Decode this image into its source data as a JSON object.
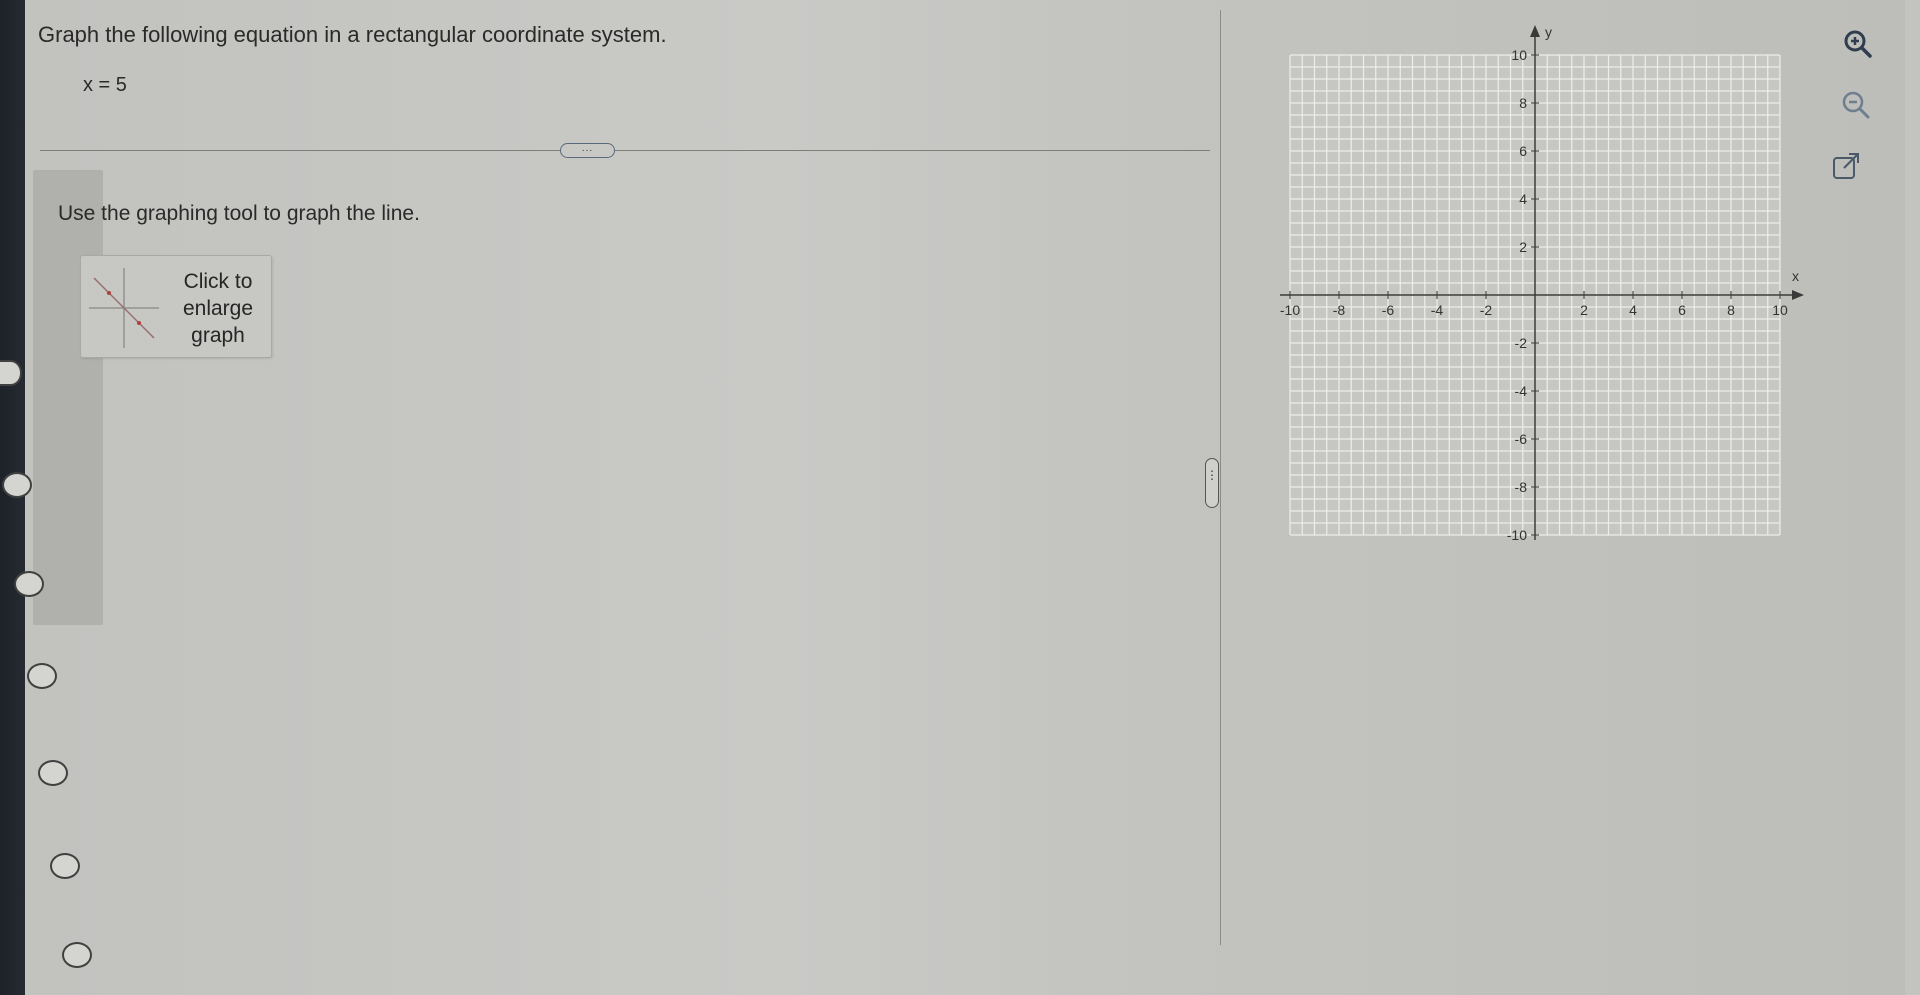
{
  "question": {
    "prompt": "Graph the following equation in a rectangular coordinate system.",
    "equation": "x = 5"
  },
  "more_button_label": "...",
  "instruction": "Use the graphing tool to graph the line.",
  "enlarge_button": {
    "lines": [
      "Click to",
      "enlarge",
      "graph"
    ]
  },
  "graph": {
    "x_label": "x",
    "y_label": "y",
    "x_range": [
      -10,
      10
    ],
    "y_range": [
      -10,
      10
    ],
    "minor_step": 1,
    "x_tick_labels": [
      "-10",
      "-8",
      "-6",
      "-4",
      "-2",
      "2",
      "4",
      "6",
      "8",
      "10"
    ],
    "y_tick_labels": [
      "10",
      "8",
      "6",
      "4",
      "2",
      "-2",
      "-4",
      "-6",
      "-8",
      "-10"
    ],
    "grid": true
  },
  "tools": {
    "zoom_in": "zoom-in-icon",
    "zoom_out": "zoom-out-icon",
    "popout": "external-link-icon"
  },
  "colors": {
    "background": "#c3c3c0",
    "grid_line": "#ededea",
    "axis": "#3a3a3a",
    "sidebar_dark": "#1d2229",
    "tool_icon": "#3a4a5a"
  }
}
